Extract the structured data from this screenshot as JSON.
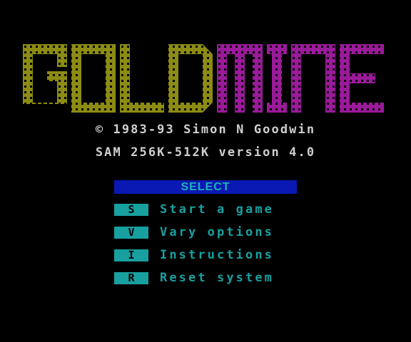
{
  "logo": {
    "word1": "GOLD",
    "word2": "MINE",
    "word1_color": "#8c8c14",
    "word2_color": "#9a1a9a"
  },
  "credits": {
    "copyright": "© 1983-93 Simon N Goodwin",
    "version": "SAM 256K-512K version 4.0"
  },
  "menu": {
    "header": "SELECT",
    "header_bg": "#0a18b4",
    "accent": "#18a0a0",
    "items": [
      {
        "key": "S",
        "label": "Start a game"
      },
      {
        "key": "V",
        "label": "Vary options"
      },
      {
        "key": "I",
        "label": "Instructions"
      },
      {
        "key": "R",
        "label": "Reset system"
      }
    ]
  }
}
